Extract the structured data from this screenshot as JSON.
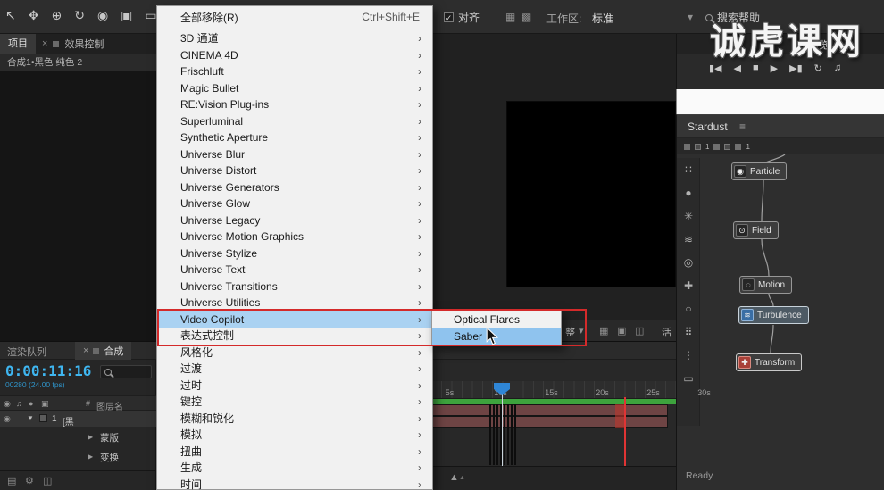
{
  "watermark": "诚虎课网",
  "toolbar": {
    "tools": [
      {
        "name": "selection-tool-icon",
        "glyph": "↖"
      },
      {
        "name": "hand-tool-icon",
        "glyph": "✥"
      },
      {
        "name": "zoom-tool-icon",
        "glyph": "⊕"
      },
      {
        "name": "rotate-tool-icon",
        "glyph": "↻"
      },
      {
        "name": "camera-tool-icon",
        "glyph": "◉"
      },
      {
        "name": "pan-behind-tool-icon",
        "glyph": "▣"
      },
      {
        "name": "mask-tool-icon",
        "glyph": "▭"
      }
    ],
    "snap_check": "✓",
    "snap_label": "对齐",
    "workspace_label": "工作区:",
    "workspace_value": "标准",
    "workspace_caret": "▾",
    "search_label": "搜索帮助"
  },
  "project_panel": {
    "project_tab": "项目",
    "close_glyph": "×",
    "effect_controls_tab": "效果控制",
    "breadcrumb": "合成1•黑色 纯色 2"
  },
  "viewer_toolbar": {
    "resolution_fragment": "整",
    "caret": "▾",
    "camera_fragment": "活"
  },
  "preview_panel": {
    "tab": "预览",
    "transport": [
      {
        "name": "first-frame-button",
        "glyph": "▮◀"
      },
      {
        "name": "previous-frame-button",
        "glyph": "◀"
      },
      {
        "name": "stop-button",
        "glyph": "■"
      },
      {
        "name": "play-button",
        "glyph": "▶"
      },
      {
        "name": "next-frame-button",
        "glyph": "▶▮"
      },
      {
        "name": "loop-button",
        "glyph": "↻"
      },
      {
        "name": "audio-button",
        "glyph": "♫"
      }
    ]
  },
  "effects_menu": {
    "header_label": "全部移除(R)",
    "header_shortcut": "Ctrl+Shift+E",
    "items": [
      "3D 通道",
      "CINEMA 4D",
      "Frischluft",
      "Magic Bullet",
      "RE:Vision Plug-ins",
      "Superluminal",
      "Synthetic Aperture",
      "Universe Blur",
      "Universe Distort",
      "Universe Generators",
      "Universe Glow",
      "Universe Legacy",
      "Universe Motion Graphics",
      "Universe Stylize",
      "Universe Text",
      "Universe Transitions",
      "Universe Utilities",
      "Video Copilot",
      "表达式控制",
      "风格化",
      "过渡",
      "过时",
      "键控",
      "模糊和锐化",
      "模拟",
      "扭曲",
      "生成",
      "时间"
    ],
    "highlighted_item": "Video Copilot",
    "submenu_items": [
      "Optical Flares",
      "Saber"
    ],
    "submenu_highlighted": "Saber"
  },
  "stardust": {
    "title": "Stardust",
    "menu_glyph": "≡",
    "badge": "1",
    "rail": [
      {
        "name": "grid-icon",
        "glyph": "∷"
      },
      {
        "name": "sphere-icon",
        "glyph": "●"
      },
      {
        "name": "swirl-icon",
        "glyph": "✳"
      },
      {
        "name": "waves-icon",
        "glyph": "≋"
      },
      {
        "name": "target-icon",
        "glyph": "◎"
      },
      {
        "name": "add-node-icon",
        "glyph": "✚"
      },
      {
        "name": "circle-icon",
        "glyph": "○"
      },
      {
        "name": "dots-icon",
        "glyph": "⠿"
      },
      {
        "name": "bars-icon",
        "glyph": "⋮"
      },
      {
        "name": "frame-icon",
        "glyph": "▭"
      }
    ],
    "nodes": [
      {
        "label": "Particle",
        "glyph": "◉"
      },
      {
        "label": "Field",
        "glyph": "⊙"
      },
      {
        "label": "Motion",
        "glyph": "◌"
      },
      {
        "label": "Turbulence",
        "glyph": "≋"
      },
      {
        "label": "Transform",
        "glyph": "✚"
      }
    ],
    "status": "Ready"
  },
  "timeline": {
    "render_queue_tab": "渲染队列",
    "close_glyph": "×",
    "comp_tab": "合成",
    "timecode": "0:00:11:16",
    "frame_info": "00280 (24.00 fps)",
    "header": {
      "eye": "◉",
      "audio": "♫",
      "solo": "●",
      "lock": "▣",
      "number": "#",
      "name": "图层名"
    },
    "layer": {
      "eye": "◉",
      "twirl": "▼",
      "number": "1",
      "name": "[黑"
    },
    "groups": [
      {
        "twirl": "▶",
        "label": "蒙版"
      },
      {
        "twirl": "▶",
        "label": "变换"
      }
    ],
    "ruler_labels": [
      "5s",
      "10s",
      "15s",
      "20s",
      "25s",
      "30s"
    ]
  }
}
